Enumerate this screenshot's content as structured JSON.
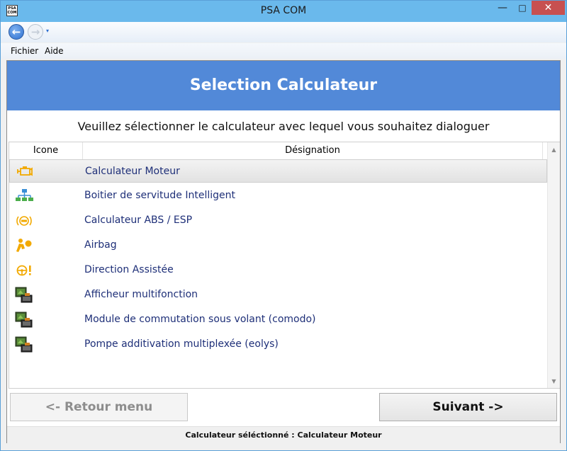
{
  "window": {
    "title": "PSA COM",
    "app_icon_text": "PSA COM",
    "minimize_glyph": "—",
    "maximize_glyph": "□",
    "close_glyph": "✕"
  },
  "toolbar": {
    "back_icon": "back-arrow-icon",
    "forward_icon": "forward-arrow-icon",
    "back_glyph": "←",
    "forward_glyph": "→",
    "dropdown_glyph": "▾"
  },
  "menu": {
    "items": [
      {
        "label": "Fichier"
      },
      {
        "label": "Aide"
      }
    ]
  },
  "header": {
    "title": "Selection Calculateur",
    "color": "#5289d8"
  },
  "instruction": "Veuillez sélectionner le calculateur avec lequel vous souhaitez dialoguer",
  "list": {
    "columns": [
      {
        "label": "Icone"
      },
      {
        "label": "Désignation"
      }
    ],
    "scroll_up_glyph": "▲",
    "scroll_down_glyph": "▼",
    "rows": [
      {
        "icon": "engine-icon",
        "label": "Calculateur Moteur",
        "selected": true
      },
      {
        "icon": "network-icon",
        "label": "Boitier de servitude Intelligent",
        "selected": false
      },
      {
        "icon": "abs-icon",
        "label": "Calculateur ABS / ESP",
        "selected": false
      },
      {
        "icon": "airbag-icon",
        "label": "Airbag",
        "selected": false
      },
      {
        "icon": "steering-warning-icon",
        "label": "Direction Assistée",
        "selected": false
      },
      {
        "icon": "ecu-board-icon",
        "label": "Afficheur multifonction",
        "selected": false
      },
      {
        "icon": "ecu-board-icon",
        "label": "Module de commutation sous volant (comodo)",
        "selected": false
      },
      {
        "icon": "ecu-board-icon",
        "label": "Pompe additivation multiplexée (eolys)",
        "selected": false
      }
    ]
  },
  "buttons": {
    "back_label": "<- Retour menu",
    "next_label": "Suivant ->"
  },
  "status": {
    "text": "Calculateur séléctionné : Calculateur Moteur"
  },
  "colors": {
    "titlebar": "#6ab9ec",
    "close_button": "#c75050",
    "list_text": "#1e2f78",
    "icon_orange": "#f2a900"
  }
}
